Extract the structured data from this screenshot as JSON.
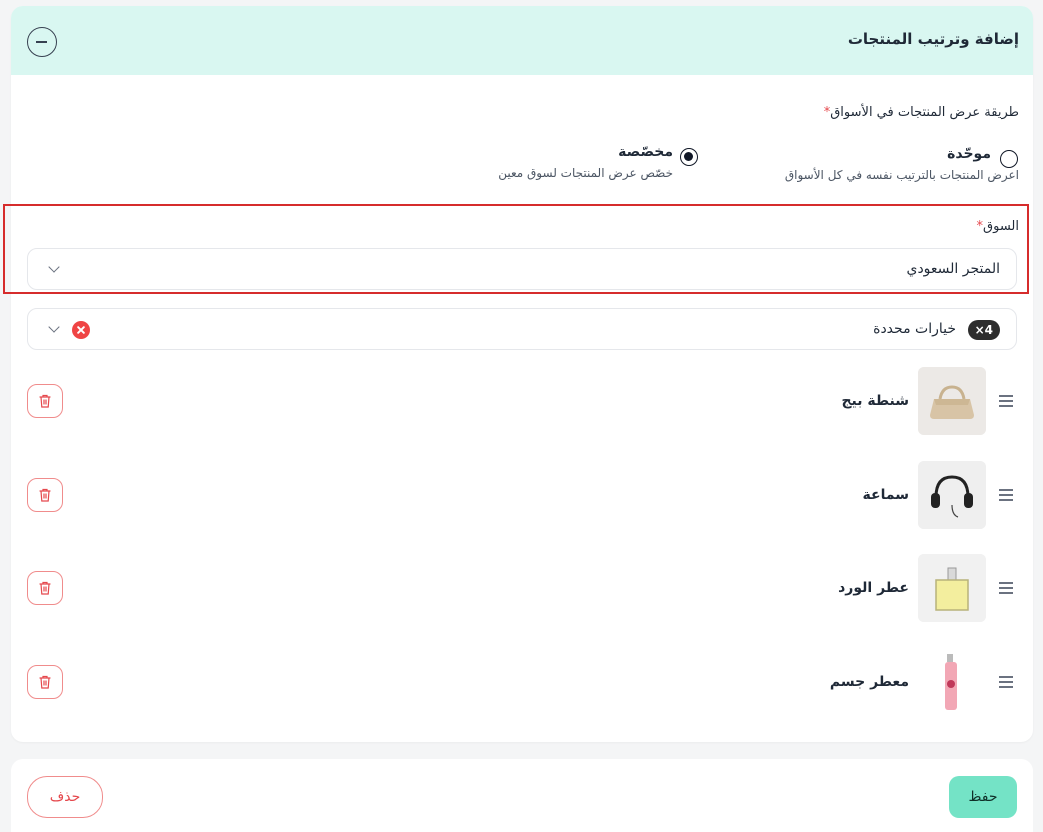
{
  "header": {
    "title": "إضافة وترتيب المنتجات"
  },
  "display_method": {
    "label": "طريقة عرض المنتجات في الأسواق",
    "required_mark": "*",
    "options": [
      {
        "title": "موحّدة",
        "description": "اعرض المنتجات بالترتيب نفسه في كل الأسواق",
        "checked": false
      },
      {
        "title": "مخصّصة",
        "description": "خصّص عرض المنتجات لسوق معين",
        "checked": true
      }
    ]
  },
  "market": {
    "label": "السوق",
    "required_mark": "*",
    "selected": "المتجر السعودي"
  },
  "products_select": {
    "value": "خيارات محددة",
    "count_badge": "×4"
  },
  "products": [
    {
      "name": "شنطة بيج",
      "image": "bag"
    },
    {
      "name": "سماعة",
      "image": "headphones"
    },
    {
      "name": "عطر الورد",
      "image": "perfume"
    },
    {
      "name": "معطر جسم",
      "image": "body-spray"
    }
  ],
  "footer": {
    "save_label": "حفظ",
    "delete_label": "حذف"
  },
  "colors": {
    "header_bg": "#d9f7f1",
    "accent": "#74e3c6",
    "danger": "#e5484d",
    "highlight": "#d62c2c"
  }
}
